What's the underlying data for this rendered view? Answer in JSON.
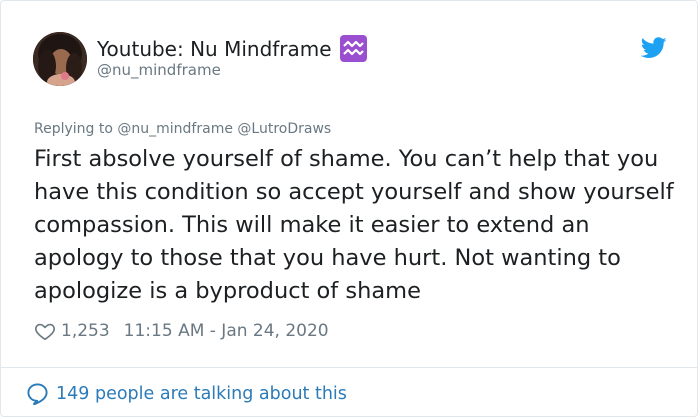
{
  "tweet": {
    "author": {
      "display_name": "Youtube: Nu Mindframe",
      "handle": "@nu_mindframe",
      "badge_icon": "aquarius-icon"
    },
    "replying_to": {
      "prefix": "Replying to",
      "users": [
        "@nu_mindframe",
        "@LutroDraws"
      ]
    },
    "text": "First absolve yourself of shame. You can’t help that you have this condition so accept yourself and show yourself compassion. This will make it easier to extend an apology to those that you have hurt. Not wanting to apologize is a byproduct of shame",
    "likes": "1,253",
    "timestamp": "11:15 AM - Jan 24, 2020",
    "conversation": "149 people are talking about this"
  },
  "colors": {
    "text": "#1c2022",
    "muted": "#697882",
    "link": "#2b7bb9",
    "twitter_blue": "#1da1f2",
    "badge_purple": "#9a4fd1",
    "border": "#e1e8ed"
  }
}
